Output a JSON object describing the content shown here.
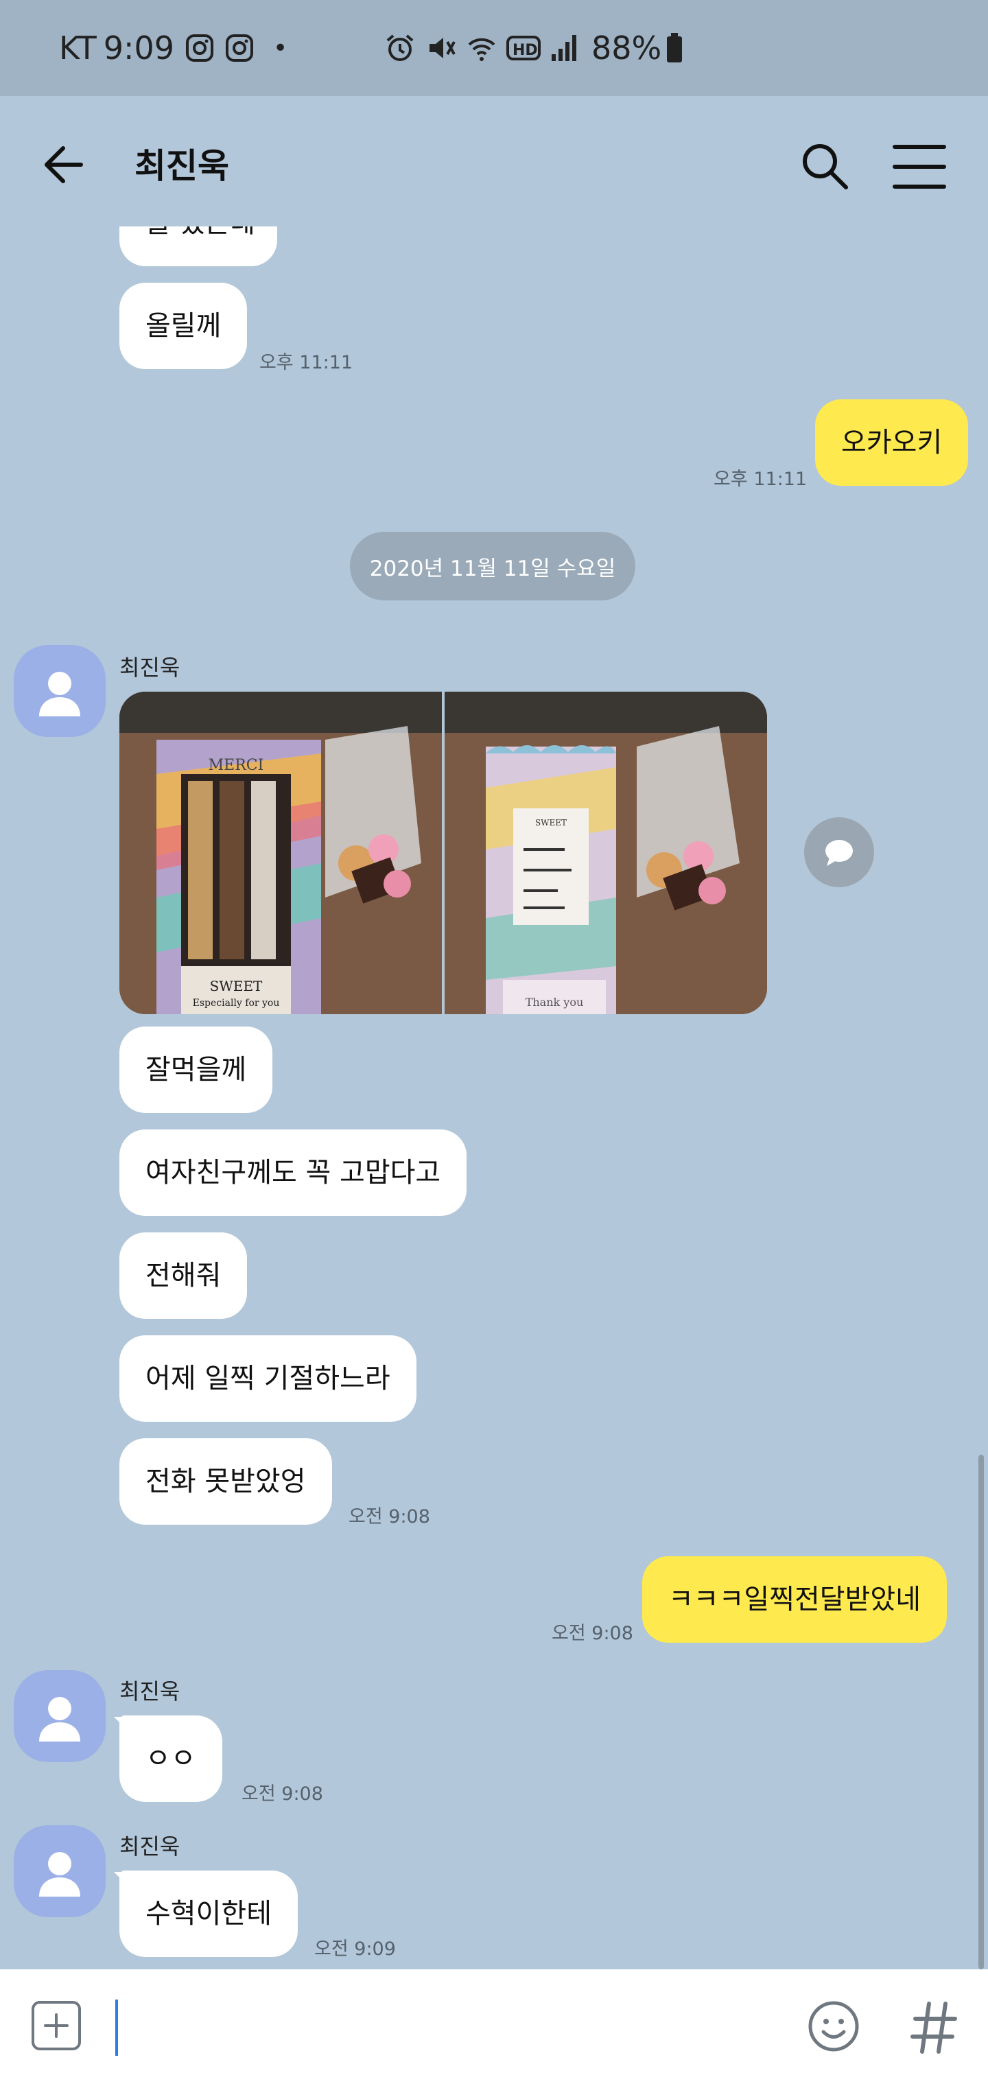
{
  "status_bar": {
    "carrier": "KT",
    "time": "9:09",
    "dot": "•",
    "battery": "88%",
    "icons": [
      "instagram-icon",
      "instagram-icon",
      "alarm-icon",
      "mute-icon",
      "wifi-icon",
      "hd-icon",
      "signal-icon",
      "battery-icon"
    ]
  },
  "header": {
    "title": "최진욱"
  },
  "date_divider": "2020년 11월 11일 수요일",
  "messages": {
    "m1": {
      "text": "을 했는데",
      "time": ""
    },
    "m2": {
      "text": "올릴께",
      "time": "오후 11:11"
    },
    "m3": {
      "text": "오카오키",
      "time": "오후 11:11"
    },
    "sender1": "최진욱",
    "m4": {
      "text": "잘먹을께"
    },
    "m5": {
      "text": "여자친구께도 꼭 고맙다고"
    },
    "m6": {
      "text": "전해줘"
    },
    "m7": {
      "text": "어제 일찍 기절하느라"
    },
    "m8": {
      "text": "전화 못받았엉",
      "time": "오전 9:08"
    },
    "m9": {
      "text": "ㅋㅋㅋ일찍전달받았네",
      "time": "오전 9:08"
    },
    "sender2": "최진욱",
    "m10": {
      "text": "ㅇㅇ",
      "time": "오전 9:08"
    },
    "sender3": "최진욱",
    "m11": {
      "text": "수혁이한테",
      "time": "오전 9:09"
    }
  },
  "photo_labels": {
    "left_top": "MERCI",
    "left_bottom": "SWEET",
    "left_sub": "Especially for you",
    "right_card": "SWEET",
    "right_bottom": "Thank you"
  },
  "input": {
    "value": "",
    "placeholder": ""
  },
  "colors": {
    "background": "#b2c7d9",
    "my_bubble": "#fee94e",
    "their_bubble": "#ffffff",
    "avatar": "#9bb0e6"
  }
}
